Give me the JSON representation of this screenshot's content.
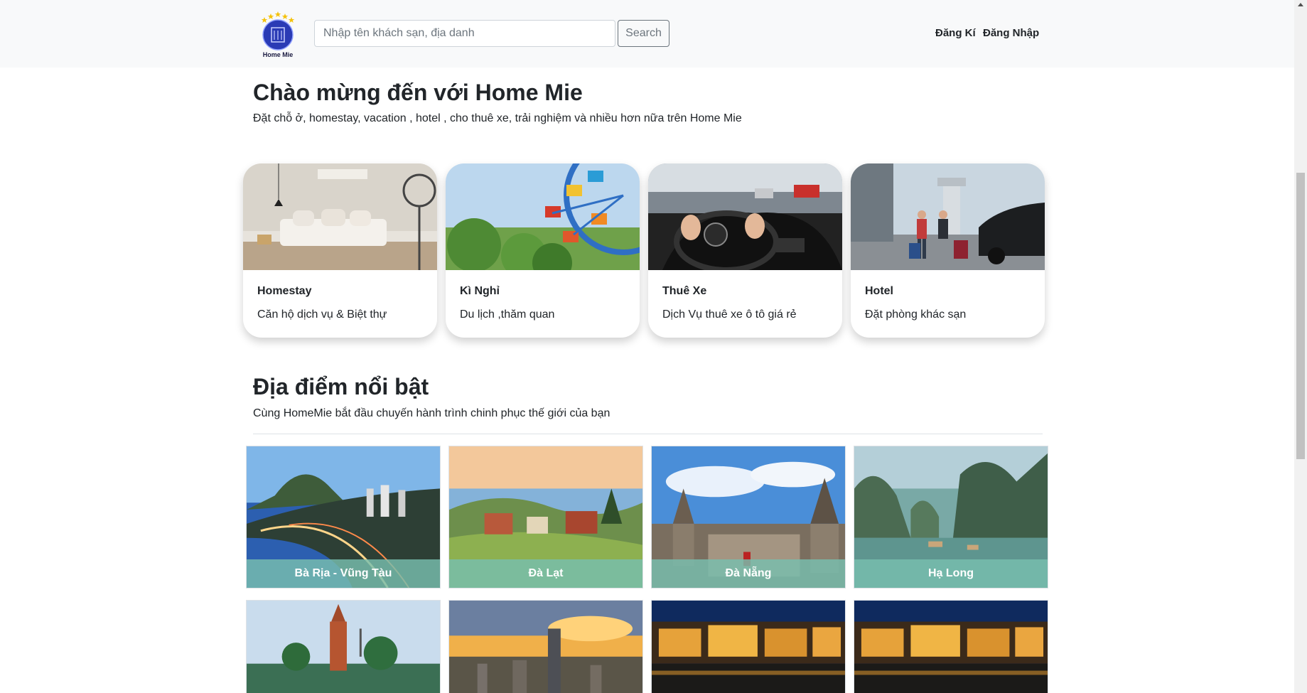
{
  "header": {
    "logo_text": "Home Mie",
    "search_placeholder": "Nhập tên khách sạn, địa danh",
    "search_button": "Search",
    "nav": {
      "register": "Đăng Kí",
      "login": "Đăng Nhập"
    }
  },
  "welcome": {
    "title": "Chào mừng đến với Home Mie",
    "subtitle": "Đặt chỗ ở, homestay, vacation , hotel , cho thuê xe, trải nghiệm và nhiều hơn nữa trên Home Mie"
  },
  "categories": [
    {
      "title": "Homestay",
      "desc": "Căn hộ dịch vụ & Biệt thự"
    },
    {
      "title": "Kì Nghỉ",
      "desc": "Du lịch ,thăm quan"
    },
    {
      "title": "Thuê Xe",
      "desc": "Dịch Vụ thuê xe ô tô giá rẻ"
    },
    {
      "title": "Hotel",
      "desc": "Đặt phòng khác sạn"
    }
  ],
  "featured": {
    "title": "Địa điểm nổi bật",
    "subtitle": "Cùng HomeMie bắt đầu chuyến hành trình chinh phục thế giới của bạn",
    "places": [
      {
        "name": "Bà Rịa - Vũng Tàu"
      },
      {
        "name": "Đà Lạt"
      },
      {
        "name": "Đà Nẵng"
      },
      {
        "name": "Hạ Long"
      }
    ]
  },
  "colors": {
    "header_bg": "#f8f9fa",
    "place_label_bg": "#78beaf",
    "logo_blue": "#2a3bb5",
    "logo_star": "#f4c20d"
  }
}
